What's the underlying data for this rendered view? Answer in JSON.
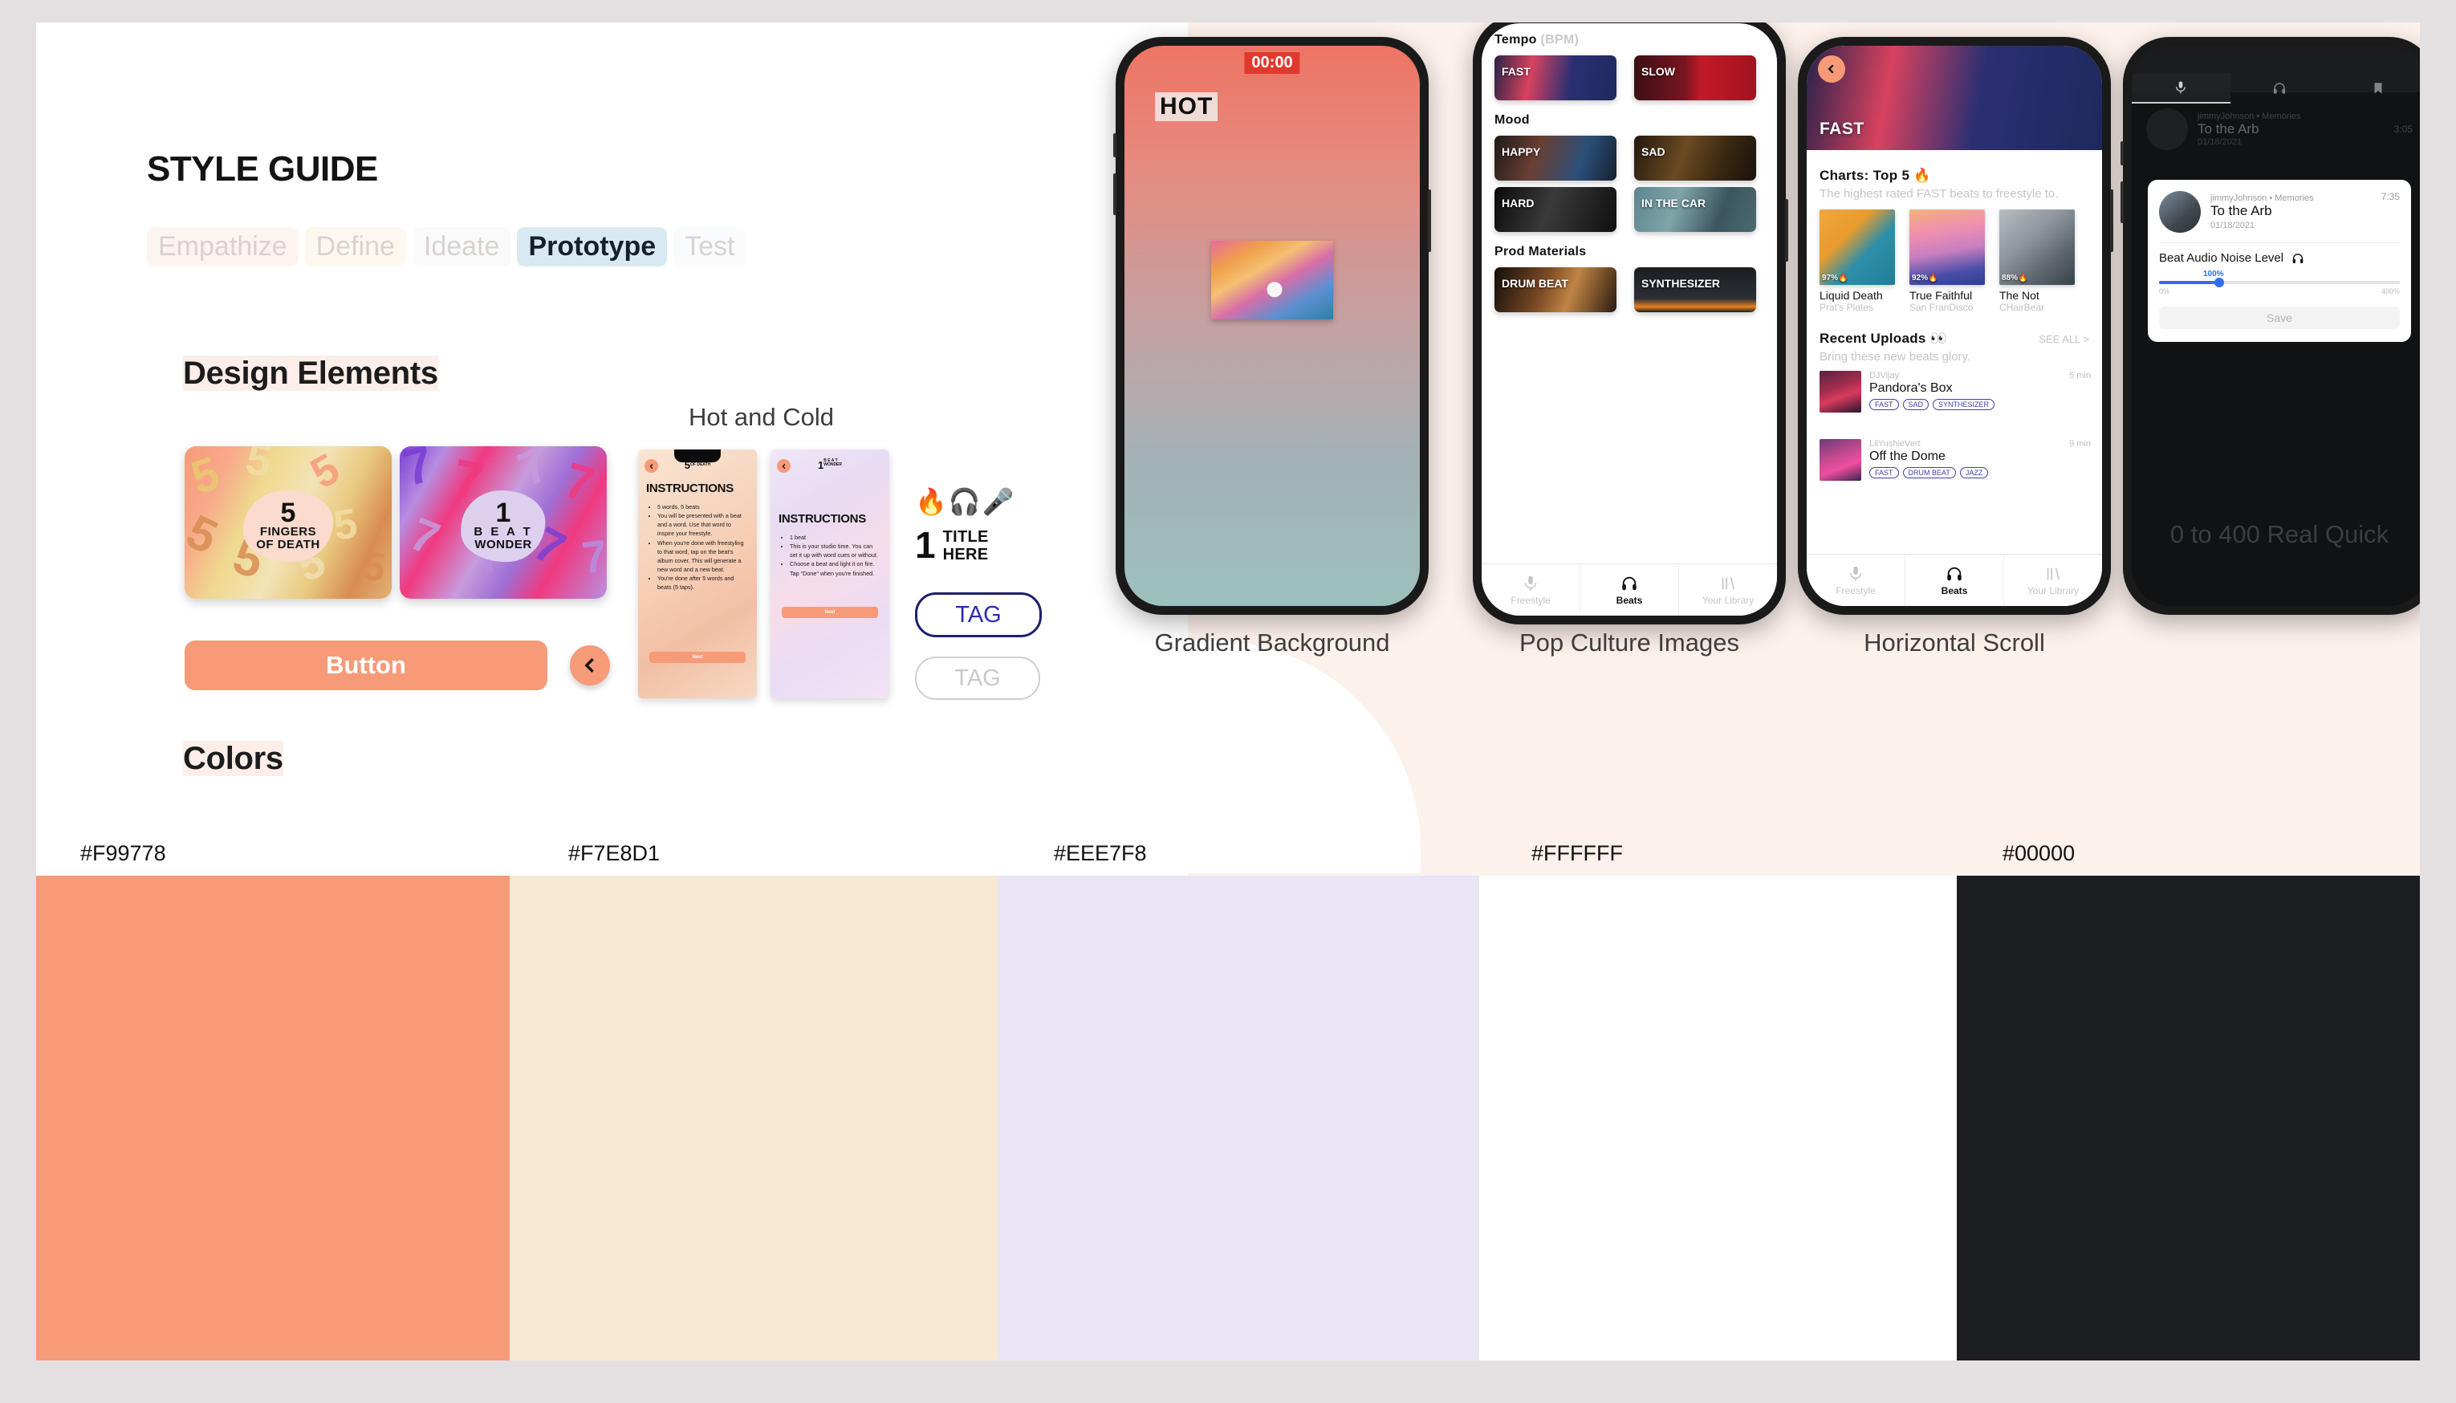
{
  "header": {
    "title": "STYLE GUIDE",
    "phases": [
      {
        "label": "Empathize",
        "active": false
      },
      {
        "label": "Define",
        "active": false
      },
      {
        "label": "Ideate",
        "active": false
      },
      {
        "label": "Prototype",
        "active": true
      },
      {
        "label": "Test",
        "active": false
      }
    ]
  },
  "sections": {
    "design_elements": "Design Elements",
    "colors": "Colors"
  },
  "design_elements": {
    "hot_and_cold_label": "Hot and Cold",
    "card_five": {
      "number": "5",
      "line1": "FINGERS",
      "line2": "OF DEATH"
    },
    "card_one": {
      "number": "1",
      "line1": "B E A T",
      "line2": "WONDER"
    },
    "button_label": "Button",
    "back_icon": "chevron-left-icon",
    "emojis": "🔥🎧🎤",
    "title_sample": {
      "number": "1",
      "line1": "TITLE",
      "line2": "HERE"
    },
    "tag_active": "TAG",
    "tag_inactive": "TAG"
  },
  "instruction_screens": {
    "five": {
      "logo_number": "5",
      "logo_sup1": "FINGERS",
      "logo_sup2": "OF DEATH",
      "heading": "INSTRUCTIONS",
      "bullets": [
        "5 words, 5 beats",
        "You will be presented with a beat and a word. Use that word to inspire your freestyle.",
        "When you're done with freestyling to that word, tap on the beat's album cover. This will generate a new word and a new beat.",
        "You're done after 5 words and beats (5 taps)."
      ],
      "next_label": "Next"
    },
    "one": {
      "logo_number": "1",
      "logo_sup1": "B E A T",
      "logo_sup2": "WONDER",
      "heading": "INSTRUCTIONS",
      "bullets": [
        "1 beat",
        "This is your studio time. You can set it up with word cues or without.",
        "Choose a beat and light it on fire. Tap \"Done\" when you're finished."
      ],
      "next_label": "Next"
    }
  },
  "colors": {
    "swatches": [
      {
        "hex_label": "#F99778",
        "color": "#f79a78"
      },
      {
        "hex_label": "#F7E8D1",
        "color": "#f7e8d1"
      },
      {
        "hex_label": "#EEE7F8",
        "color": "#eae5f5"
      },
      {
        "hex_label": "#FFFFFF",
        "color": "#ffffff"
      },
      {
        "hex_label": "#00000",
        "color": "#1c1e21"
      }
    ]
  },
  "phones": {
    "gradient": {
      "caption": "Gradient Background",
      "timer": "00:00",
      "word": "HOT"
    },
    "pop_culture": {
      "caption": "Pop Culture Images",
      "sections": [
        {
          "title": "Tempo",
          "title_dim": "(BPM)",
          "tiles": [
            {
              "label": "FAST"
            },
            {
              "label": "SLOW"
            }
          ]
        },
        {
          "title": "Mood",
          "title_dim": "",
          "tiles": [
            {
              "label": "HAPPY"
            },
            {
              "label": "SAD"
            },
            {
              "label": "HARD"
            },
            {
              "label": "IN THE CAR"
            }
          ]
        },
        {
          "title": "Prod Materials",
          "title_dim": "",
          "tiles": [
            {
              "label": "DRUM BEAT"
            },
            {
              "label": "SYNTHESIZER"
            }
          ]
        }
      ],
      "tabs": [
        {
          "label": "Freestyle",
          "icon": "microphone-icon",
          "active": false
        },
        {
          "label": "Beats",
          "icon": "headphones-icon",
          "active": true
        },
        {
          "label": "Your Library",
          "icon": "library-icon",
          "active": false
        }
      ]
    },
    "horizontal_scroll": {
      "caption": "Horizontal Scroll",
      "hero_label": "FAST",
      "charts": {
        "title": "Charts: Top 5 🔥",
        "subtitle": "The highest rated FAST beats to freestyle to.",
        "items": [
          {
            "name": "Liquid Death",
            "artist": "Prat's Plates",
            "percent": "97%"
          },
          {
            "name": "True Faithful",
            "artist": "San FranDisco",
            "percent": "92%"
          },
          {
            "name": "The Not",
            "artist": "CHairBear",
            "percent": "88%"
          }
        ]
      },
      "recent": {
        "title": "Recent Uploads 👀",
        "see_all": "SEE ALL >",
        "subtitle": "Bring these new beats glory.",
        "items": [
          {
            "user": "DJVijay",
            "time": "5 min",
            "title": "Pandora's Box",
            "tags": [
              "FAST",
              "SAD",
              "SYNTHESIZER"
            ]
          },
          {
            "user": "LilYushieVert",
            "time": "9 min",
            "title": "Off the Dome",
            "tags": [
              "FAST",
              "DRUM BEAT",
              "JAZZ"
            ]
          }
        ]
      },
      "tabs": [
        {
          "label": "Freestyle",
          "icon": "microphone-icon",
          "active": false
        },
        {
          "label": "Beats",
          "icon": "headphones-icon",
          "active": true
        },
        {
          "label": "Your Library",
          "icon": "library-icon",
          "active": false
        }
      ]
    },
    "save_sheet": {
      "caption": "0 to 400 Real Quick",
      "background_track": {
        "user": "jimmyJohnson • Memories",
        "title": "To the Arb",
        "date": "01/18/2021",
        "duration": "3:05"
      },
      "sheet": {
        "user": "jimmyJohnson • Memories",
        "title": "To the Arb",
        "date": "01/18/2021",
        "duration": "7:35",
        "slider_label": "Beat Audio Noise Level",
        "slider_icon": "headphones-icon",
        "slider_value": "100%",
        "slider_min": "0%",
        "slider_max": "400%",
        "save_label": "Save"
      }
    }
  }
}
